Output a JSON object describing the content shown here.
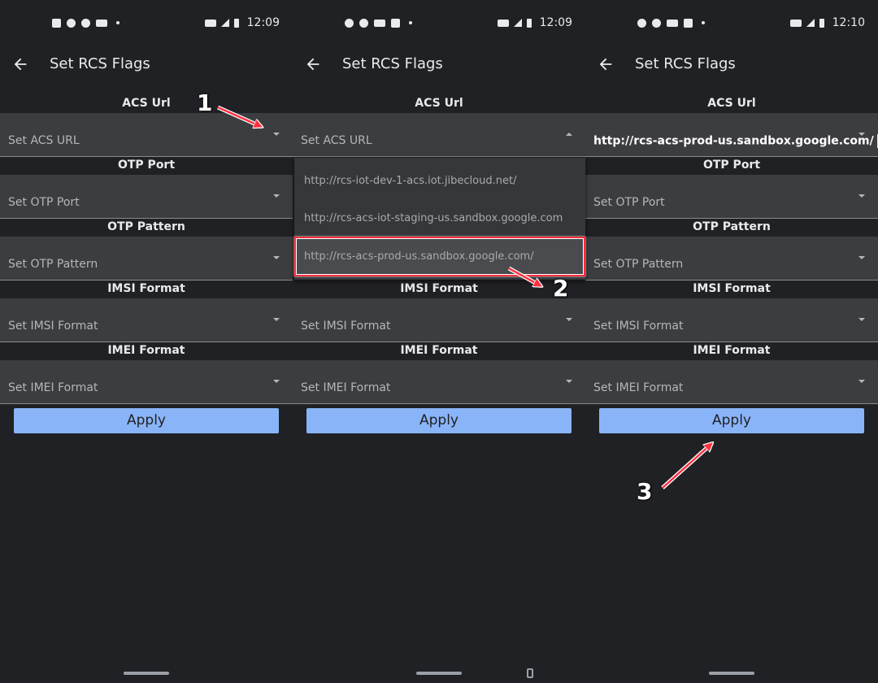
{
  "screens": [
    {
      "status": {
        "time": "12:09"
      },
      "app_bar": {
        "title": "Set RCS Flags"
      },
      "sections": [
        {
          "label": "ACS Url",
          "field": "Set ACS URL"
        },
        {
          "label": "OTP Port",
          "field": "Set OTP Port"
        },
        {
          "label": "OTP Pattern",
          "field": "Set OTP Pattern"
        },
        {
          "label": "IMSI Format",
          "field": "Set IMSI Format"
        },
        {
          "label": "IMEI Format",
          "field": "Set IMEI Format"
        }
      ],
      "apply_label": "Apply"
    },
    {
      "status": {
        "time": "12:09"
      },
      "app_bar": {
        "title": "Set RCS Flags"
      },
      "sections": [
        {
          "label": "ACS Url",
          "field": "Set ACS URL"
        },
        {
          "label": "IMSI Format",
          "field": "Set IMSI Format"
        },
        {
          "label": "IMEI Format",
          "field": "Set IMEI Format"
        }
      ],
      "dropdown_options": [
        "http://rcs-iot-dev-1-acs.iot.jibecloud.net/",
        "http://rcs-acs-iot-staging-us.sandbox.google.com",
        "http://rcs-acs-prod-us.sandbox.google.com/"
      ],
      "apply_label": "Apply"
    },
    {
      "status": {
        "time": "12:10"
      },
      "app_bar": {
        "title": "Set RCS Flags"
      },
      "sections": [
        {
          "label": "ACS Url",
          "field": "http://rcs-acs-prod-us.sandbox.google.com/"
        },
        {
          "label": "OTP Port",
          "field": "Set OTP Port"
        },
        {
          "label": "OTP Pattern",
          "field": "Set OTP Pattern"
        },
        {
          "label": "IMSI Format",
          "field": "Set IMSI Format"
        },
        {
          "label": "IMEI Format",
          "field": "Set IMEI Format"
        }
      ],
      "apply_label": "Apply"
    }
  ],
  "annotations": [
    "1",
    "2",
    "3"
  ],
  "colors": {
    "background": "#202124",
    "field": "#3c3d40",
    "accent_button": "#8ab4f8",
    "highlight": "#ff2f3f"
  },
  "icons": [
    "back-arrow-icon",
    "dropdown-caret-icon",
    "signal-icon",
    "battery-icon",
    "rotate-icon"
  ]
}
